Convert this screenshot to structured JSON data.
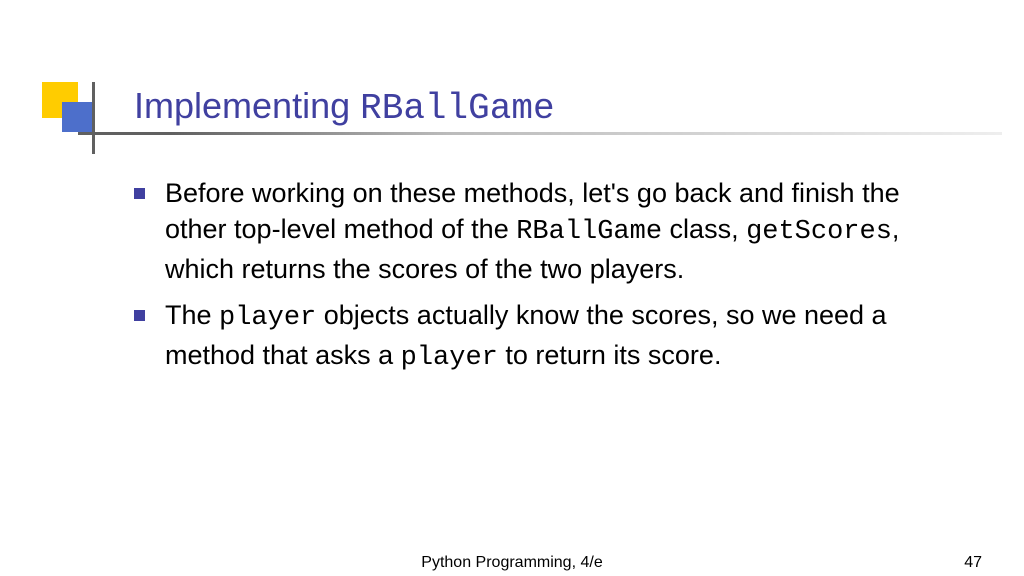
{
  "title": {
    "prefix": "Implementing ",
    "code": "RBallGame"
  },
  "bullets": [
    {
      "segments": [
        {
          "t": "Before working on these methods, let",
          "mono": false
        },
        {
          "t": "'",
          "mono": false
        },
        {
          "t": "s go back and finish the other top-level method of the ",
          "mono": false
        },
        {
          "t": "RBallGame",
          "mono": true
        },
        {
          "t": " class, ",
          "mono": false
        },
        {
          "t": "getScores",
          "mono": true
        },
        {
          "t": ", which returns the scores of the two players.",
          "mono": false
        }
      ]
    },
    {
      "segments": [
        {
          "t": "The ",
          "mono": false
        },
        {
          "t": "player",
          "mono": true
        },
        {
          "t": " objects actually know the scores, so we need a method that asks a ",
          "mono": false
        },
        {
          "t": "player",
          "mono": true
        },
        {
          "t": " to return its score.",
          "mono": false
        }
      ]
    }
  ],
  "footer": {
    "center": "Python Programming, 4/e",
    "page": "47"
  }
}
